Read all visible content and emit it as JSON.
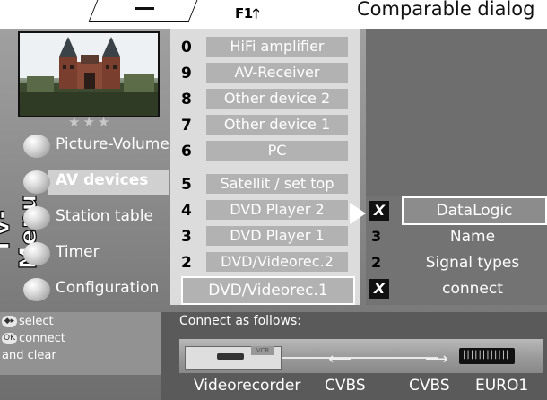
{
  "header": {
    "key_hint": "F1",
    "arrow_glyph": "🡑",
    "caption": "Comparable dialog"
  },
  "sidebar": {
    "menu_title": "TV-Menu",
    "stars": "★★★",
    "items": [
      {
        "label": "Picture-Volume",
        "selected": false
      },
      {
        "label": "AV devices",
        "selected": true
      },
      {
        "label": "Station table",
        "selected": false
      },
      {
        "label": "Timer",
        "selected": false
      },
      {
        "label": "Configuration",
        "selected": false
      }
    ],
    "help": {
      "line1_icon": "◆▸",
      "line1": "select",
      "line2_icon": "OK",
      "line2": "connect",
      "line3": "and clear"
    }
  },
  "devices": [
    {
      "num": "0",
      "label": "HiFi amplifier"
    },
    {
      "num": "9",
      "label": "AV-Receiver"
    },
    {
      "num": "8",
      "label": "Other device 2"
    },
    {
      "num": "7",
      "label": "Other device 1"
    },
    {
      "num": "6",
      "label": "PC"
    },
    {
      "num": "5",
      "label": "Satellit / set top"
    },
    {
      "num": "4",
      "label": "DVD Player 2"
    },
    {
      "num": "3",
      "label": "DVD Player 1"
    },
    {
      "num": "2",
      "label": "DVD/Videorec.2"
    },
    {
      "num": "",
      "label": "DVD/Videorec.1",
      "selected": true
    }
  ],
  "options": [
    {
      "key": "X",
      "label": "DataLogic",
      "selected": true
    },
    {
      "key": "3",
      "label": "Name",
      "selected": false
    },
    {
      "key": "2",
      "label": "Signal types",
      "selected": false
    },
    {
      "key": "X",
      "label": "connect",
      "selected": false
    }
  ],
  "connection": {
    "title": "Connect as follows:",
    "device": "Videorecorder",
    "signal_left": "CVBS",
    "signal_right": "CVBS",
    "socket": "EURO1",
    "vcr_tag": "VCR",
    "scart_pins": "||||||||||||"
  },
  "colors": {
    "panel": "#8a8a8a",
    "list_bg": "#dcdcdc",
    "label_box": "#b2b2b2",
    "right_panel": "#737373"
  }
}
